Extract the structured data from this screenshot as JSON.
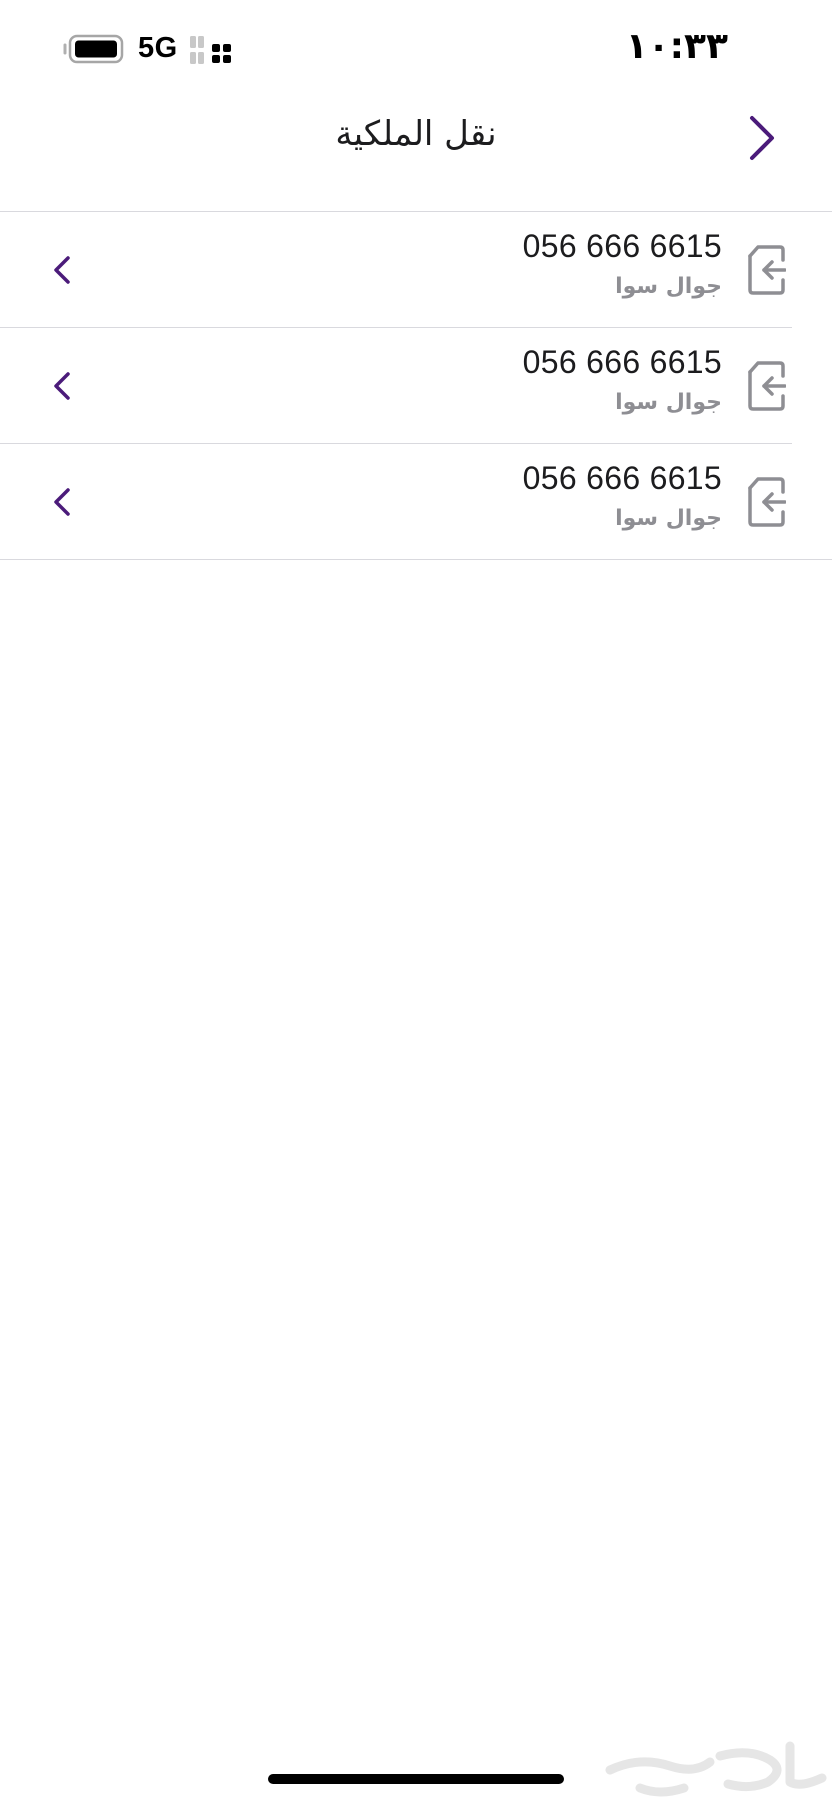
{
  "status_bar": {
    "time": "١٠:٣٣",
    "network": "5G",
    "icons": [
      "battery-icon",
      "signal-icon"
    ]
  },
  "header": {
    "title": "نقل الملكية",
    "back_icon": "chevron-right-icon"
  },
  "lines": [
    {
      "number": "056 666 6615",
      "type": "جوال سوا",
      "icon": "transfer-in-icon"
    },
    {
      "number": "056 666 6615",
      "type": "جوال سوا",
      "icon": "transfer-in-icon"
    },
    {
      "number": "056 666 6615",
      "type": "جوال سوا",
      "icon": "transfer-in-icon"
    }
  ],
  "colors": {
    "accent": "#4b1b7a",
    "icon_gray": "#8e8e93",
    "separator": "#d9d9de",
    "text": "#1c1c1e"
  },
  "watermark": {
    "icon": "haraj-logo-watermark"
  }
}
